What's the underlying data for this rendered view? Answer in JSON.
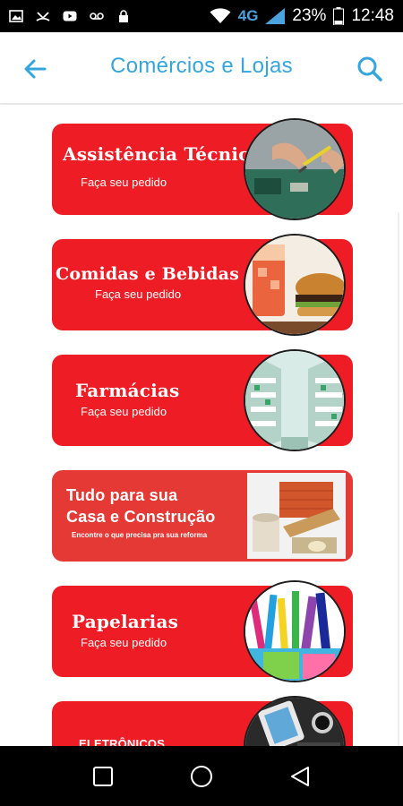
{
  "status_bar": {
    "network": "4G",
    "battery": "23%",
    "time": "12:48"
  },
  "app_bar": {
    "title": "Comércios e Lojas",
    "back_icon": "arrow-left-icon",
    "search_icon": "search-icon"
  },
  "colors": {
    "accent": "#34a6dd",
    "card_red": "#ee1c24",
    "card_red_alt": "#e53935"
  },
  "categories": [
    {
      "title": "Assistência Técnica",
      "subtitle": "Faça seu pedido",
      "image": "electronics-repair-photo"
    },
    {
      "title": "Comidas e Bebidas",
      "subtitle": "Faça seu pedido",
      "image": "burger-and-soda-photo"
    },
    {
      "title": "Farmácias",
      "subtitle": "Faça seu pedido",
      "image": "pharmacy-shelves-photo"
    },
    {
      "title_line1": "Tudo para sua",
      "title_line2": "Casa e Construção",
      "subtitle": "Encontre o que precisa pra sua reforma",
      "image": "construction-materials-photo"
    },
    {
      "title": "Papelarias",
      "subtitle": "Faça seu pedido",
      "image": "stationery-supplies-photo"
    },
    {
      "title": "ELETRÔNICOS",
      "image": "electronics-devices-photo"
    }
  ],
  "nav_bar": {
    "recent_icon": "square-recent-apps-icon",
    "home_icon": "circle-home-icon",
    "back_icon": "triangle-back-icon"
  }
}
